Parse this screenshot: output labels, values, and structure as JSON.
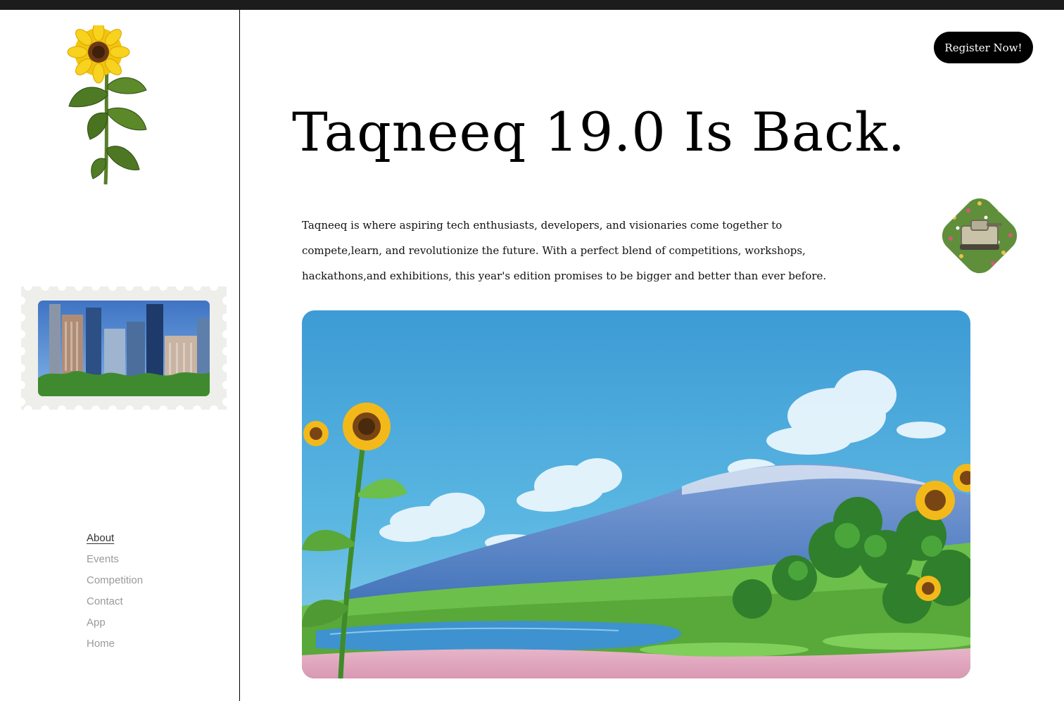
{
  "header": {
    "register_label": "Register Now!"
  },
  "hero": {
    "headline": "Taqneeq 19.0 Is Back.",
    "intro": "Taqneeq is where aspiring tech enthusiasts, developers, and visionaries come together to compete,learn, and revolutionize the future. With a perfect blend of competitions, workshops, hackathons,and exhibitions, this year's edition promises to be bigger and better than ever before."
  },
  "sidebar": {
    "nav": [
      {
        "label": "About",
        "active": true
      },
      {
        "label": "Events",
        "active": false
      },
      {
        "label": "Competition",
        "active": false
      },
      {
        "label": "Contact",
        "active": false
      },
      {
        "label": "App",
        "active": false
      },
      {
        "label": "Home",
        "active": false
      }
    ]
  },
  "colors": {
    "topbar": "#1c1c1c",
    "button_bg": "#000000",
    "nav_active": "#333333",
    "nav_inactive": "#9a9a9a",
    "sky": "#4aa3d8"
  },
  "icons": [
    "sunflower-illustration",
    "city-stamp-image",
    "diamond-tank-image",
    "landscape-hero-image"
  ]
}
